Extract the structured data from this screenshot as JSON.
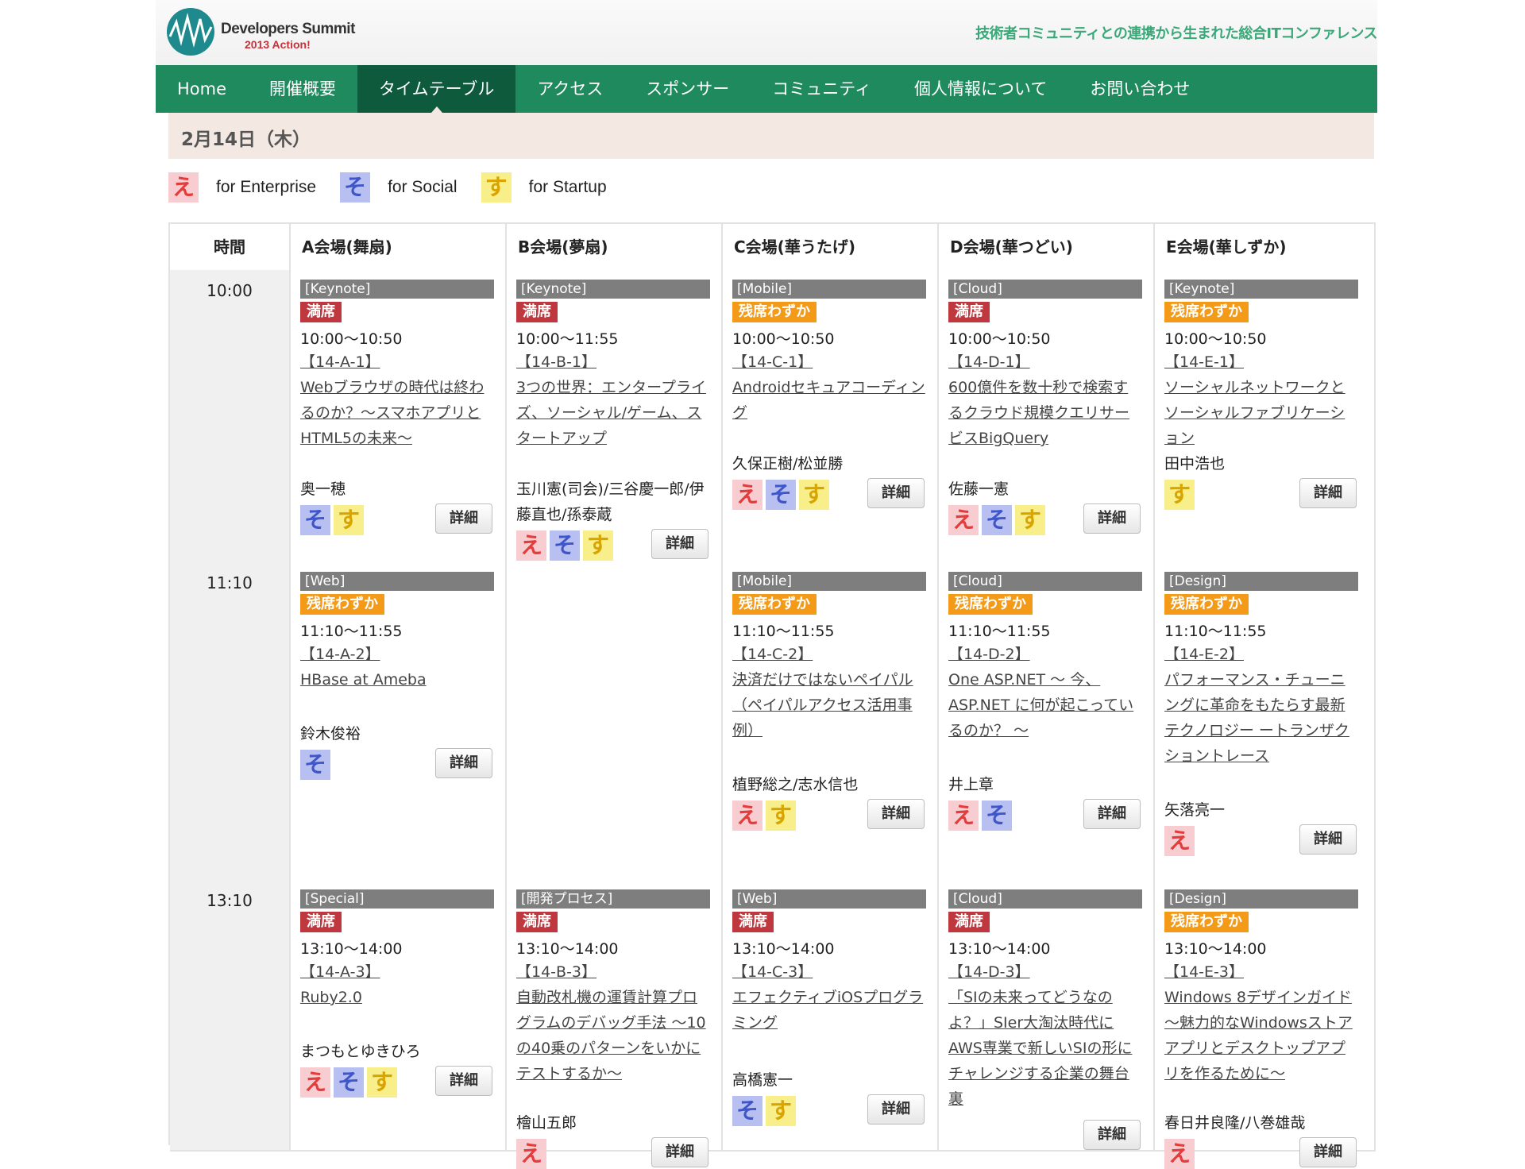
{
  "header": {
    "logo_title": "Developers Summit",
    "logo_sub": "2013 Action!",
    "tagline": "技術者コミュニティとの連携から生まれた総合ITコンファレンス"
  },
  "nav": {
    "items": [
      "Home",
      "開催概要",
      "タイムテーブル",
      "アクセス",
      "スポンサー",
      "コミュニティ",
      "個人情報について",
      "お問い合わせ"
    ],
    "active_index": 2
  },
  "date_label": "2月14日（木）",
  "legend": [
    {
      "glyph": "え",
      "label": "for Enterprise",
      "kind": "e"
    },
    {
      "glyph": "そ",
      "label": "for Social",
      "kind": "s"
    },
    {
      "glyph": "す",
      "label": "for Startup",
      "kind": "t"
    }
  ],
  "table": {
    "headers": [
      "時間",
      "A会場(舞扇)",
      "B会場(夢扇)",
      "C会場(華うたげ)",
      "D会場(華つどい)",
      "E会場(華しずか)"
    ],
    "detail_label": "詳細",
    "rows": [
      {
        "time": "10:00",
        "sessions": [
          {
            "track": "[Keynote]",
            "status": "満席",
            "status_kind": "full",
            "time": "10:00〜10:50",
            "code": "【14-A-1】",
            "title": "Webブラウザの時代は終わるのか？〜スマホアプリとHTML5の未来〜",
            "speaker": "奥一穂",
            "tags": [
              "s",
              "t"
            ]
          },
          {
            "track": "[Keynote]",
            "status": "満席",
            "status_kind": "full",
            "time": "10:00〜11:55",
            "code": "【14-B-1】",
            "title": "3つの世界：エンタープライズ、ソーシャル/ゲーム、スタートアップ",
            "speaker": "玉川憲(司会)/三谷慶一郎/伊藤直也/孫泰蔵",
            "tags": [
              "e",
              "s",
              "t"
            ]
          },
          {
            "track": "[Mobile]",
            "status": "残席わずか",
            "status_kind": "few",
            "time": "10:00〜10:50",
            "code": "【14-C-1】",
            "title": "Androidセキュアコーディング",
            "speaker": "久保正樹/松並勝",
            "tags": [
              "e",
              "s",
              "t"
            ]
          },
          {
            "track": "[Cloud]",
            "status": "満席",
            "status_kind": "full",
            "time": "10:00〜10:50",
            "code": "【14-D-1】",
            "title": "600億件を数十秒で検索するクラウド規模クエリサービスBigQuery",
            "speaker": "佐藤一憲",
            "tags": [
              "e",
              "s",
              "t"
            ]
          },
          {
            "track": "[Keynote]",
            "status": "残席わずか",
            "status_kind": "few",
            "time": "10:00〜10:50",
            "code": "【14-E-1】",
            "title": "ソーシャルネットワークとソーシャルファブリケーション",
            "speaker": "田中浩也",
            "tags": [
              "t"
            ]
          }
        ]
      },
      {
        "time": "11:10",
        "sessions": [
          {
            "track": "[Web]",
            "status": "残席わずか",
            "status_kind": "few",
            "time": "11:10〜11:55",
            "code": "【14-A-2】",
            "title": "HBase at Ameba",
            "speaker": "鈴木俊裕",
            "tags": [
              "s"
            ]
          },
          null,
          {
            "track": "[Mobile]",
            "status": "残席わずか",
            "status_kind": "few",
            "time": "11:10〜11:55",
            "code": "【14-C-2】",
            "title": "決済だけではないペイパル（ペイパルアクセス活用事例）",
            "speaker": "植野総之/志水信也",
            "tags": [
              "e",
              "t"
            ]
          },
          {
            "track": "[Cloud]",
            "status": "残席わずか",
            "status_kind": "few",
            "time": "11:10〜11:55",
            "code": "【14-D-2】",
            "title": "One ASP.NET 〜 今、ASP.NET に何が起こっているのか？ 〜",
            "speaker": "井上章",
            "tags": [
              "e",
              "s"
            ]
          },
          {
            "track": "[Design]",
            "status": "残席わずか",
            "status_kind": "few",
            "time": "11:10〜11:55",
            "code": "【14-E-2】",
            "title": "パフォーマンス・チューニングに革命をもたらす最新テクノロジー ートランザクショントレース",
            "speaker": "矢落亮一",
            "tags": [
              "e"
            ]
          }
        ]
      },
      {
        "time": "13:10",
        "sessions": [
          {
            "track": "[Special]",
            "status": "満席",
            "status_kind": "full",
            "time": "13:10〜14:00",
            "code": "【14-A-3】",
            "title": "Ruby2.0",
            "speaker": "まつもとゆきひろ",
            "tags": [
              "e",
              "s",
              "t"
            ]
          },
          {
            "track": "[開発プロセス]",
            "status": "満席",
            "status_kind": "full",
            "time": "13:10〜14:00",
            "code": "【14-B-3】",
            "title": "自動改札機の運賃計算プログラムのデバッグ手法 〜10の40乗のパターンをいかにテストするか〜",
            "speaker": "檜山五郎",
            "tags": [
              "e"
            ]
          },
          {
            "track": "[Web]",
            "status": "満席",
            "status_kind": "full",
            "time": "13:10〜14:00",
            "code": "【14-C-3】",
            "title": "エフェクティブiOSプログラミング",
            "speaker": "高橋憲一",
            "tags": [
              "s",
              "t"
            ]
          },
          {
            "track": "[Cloud]",
            "status": "満席",
            "status_kind": "full",
            "time": "13:10〜14:00",
            "code": "【14-D-3】",
            "title": "「SIの未来ってどうなの よ？」SIer大淘汰時代にAWS専業で新しいSIの形にチャレンジする企業の舞台裏",
            "speaker": "",
            "tags": []
          },
          {
            "track": "[Design]",
            "status": "残席わずか",
            "status_kind": "few",
            "time": "13:10〜14:00",
            "code": "【14-E-3】",
            "title": "Windows 8デザインガイド 〜魅力的なWindowsストアアプリとデスクトップアプリを作るために〜",
            "speaker": "春日井良隆/八巻雄哉",
            "tags": [
              "e"
            ]
          }
        ]
      }
    ]
  },
  "colors": {
    "nav_bg": "#1f8a5e",
    "nav_active": "#0e5a3c",
    "full": "#c0383f",
    "few": "#f39a18",
    "tagline": "#3aa878"
  }
}
